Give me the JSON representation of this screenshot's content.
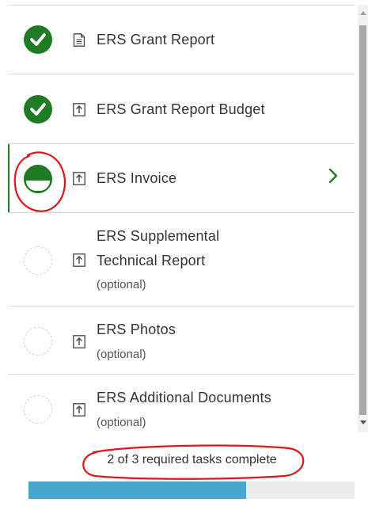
{
  "tasks": [
    {
      "name_lines": [
        "ERS Grant Report"
      ],
      "optional_label": "",
      "status": "complete",
      "icon": "document-icon"
    },
    {
      "name_lines": [
        "ERS Grant Report Budget"
      ],
      "optional_label": "",
      "status": "complete",
      "icon": "upload-icon"
    },
    {
      "name_lines": [
        "ERS Invoice"
      ],
      "optional_label": "",
      "status": "in-progress",
      "icon": "upload-icon",
      "active": true
    },
    {
      "name_lines": [
        "ERS Supplemental",
        "Technical Report"
      ],
      "optional_label": "(optional)",
      "status": "not-started",
      "icon": "upload-icon"
    },
    {
      "name_lines": [
        "ERS Photos"
      ],
      "optional_label": "(optional)",
      "status": "not-started",
      "icon": "upload-icon"
    },
    {
      "name_lines": [
        "ERS Additional Documents"
      ],
      "optional_label": "(optional)",
      "status": "not-started",
      "icon": "upload-icon"
    }
  ],
  "progress": {
    "text": "2 of 3 required tasks complete",
    "completed": 2,
    "required": 3
  },
  "colors": {
    "complete": "#1e7d22",
    "progress_fill": "#4aa5ce",
    "annotation": "#e0141e"
  }
}
